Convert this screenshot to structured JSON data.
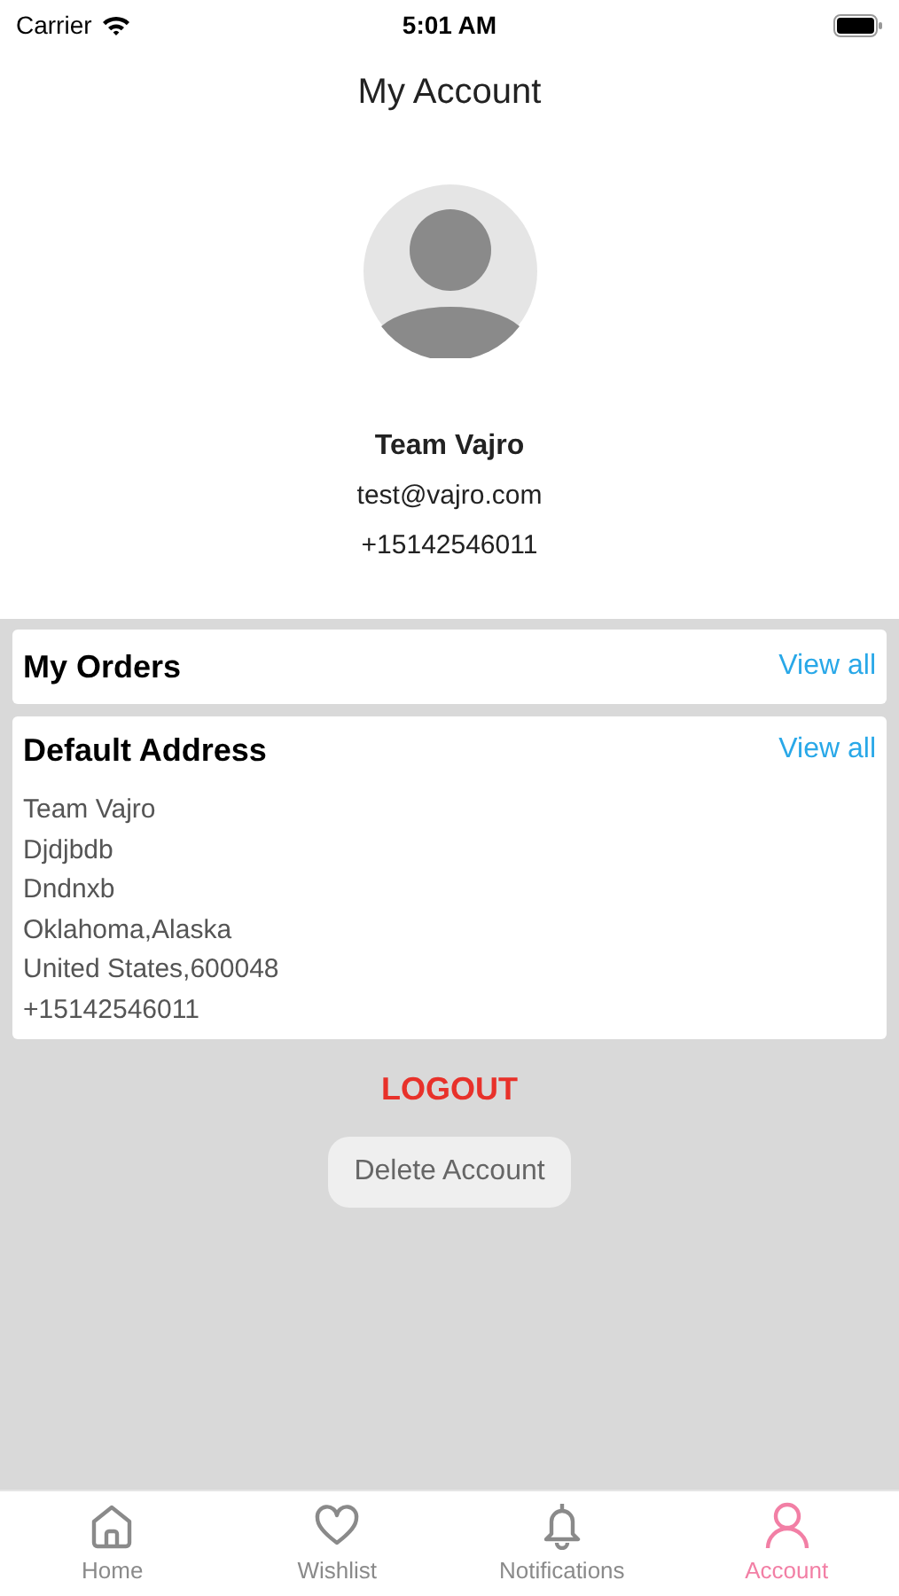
{
  "status_bar": {
    "carrier": "Carrier",
    "time": "5:01 AM"
  },
  "title": "My Account",
  "profile": {
    "name": "Team Vajro",
    "email": "test@vajro.com",
    "phone": "+15142546011"
  },
  "orders": {
    "title": "My Orders",
    "link": "View all"
  },
  "address": {
    "title": "Default Address",
    "link": "View all",
    "lines": [
      "Team Vajro",
      "Djdjbdb",
      "Dndnxb",
      "Oklahoma,Alaska",
      "United States,600048",
      "+15142546011"
    ]
  },
  "logout": "LOGOUT",
  "delete_button": "Delete Account",
  "tabs": [
    {
      "label": "Home",
      "selected": false
    },
    {
      "label": "Wishlist",
      "selected": false
    },
    {
      "label": "Notifications",
      "selected": false
    },
    {
      "label": "Account",
      "selected": true
    }
  ]
}
